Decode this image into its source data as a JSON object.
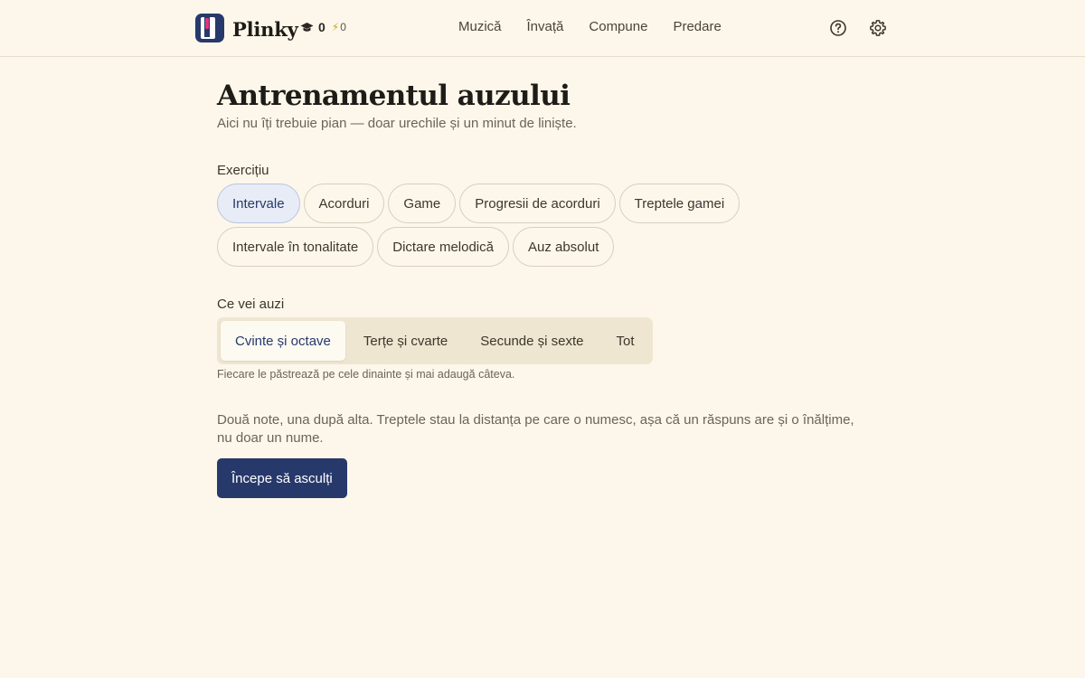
{
  "header": {
    "brand": "Plinky",
    "stats": {
      "level": "0",
      "streak": "0"
    },
    "nav": [
      "Muzică",
      "Învață",
      "Compune",
      "Predare"
    ],
    "icons": {
      "help": "help-icon",
      "settings": "gear-icon",
      "level": "graduation-cap-icon",
      "streak": "bolt-icon"
    }
  },
  "main": {
    "title": "Antrenamentul auzului",
    "subtitle": "Aici nu îți trebuie pian — doar urechile și un minut de liniște.",
    "exercise": {
      "label": "Exercițiu",
      "options": [
        "Intervale",
        "Acorduri",
        "Game",
        "Progresii de acorduri",
        "Treptele gamei",
        "Intervale în tonalitate",
        "Dictare melodică",
        "Auz absolut"
      ],
      "selected": "Intervale"
    },
    "hear": {
      "label": "Ce vei auzi",
      "options": [
        "Cvinte și octave",
        "Terțe și cvarte",
        "Secunde și sexte",
        "Tot"
      ],
      "selected": "Cvinte și octave",
      "hint": "Fiecare le păstrează pe cele dinainte și mai adaugă câteva."
    },
    "description": "Două note, una după alta. Treptele stau la distanța pe care o numesc, așa că un răspuns are și o înălțime, nu doar un nume.",
    "start_label": "Începe să asculți"
  },
  "colors": {
    "background": "#fcf7ea",
    "accent": "#27396b",
    "chip_active_bg": "#e8ecf6",
    "segmented_bg": "#efe6d1"
  }
}
